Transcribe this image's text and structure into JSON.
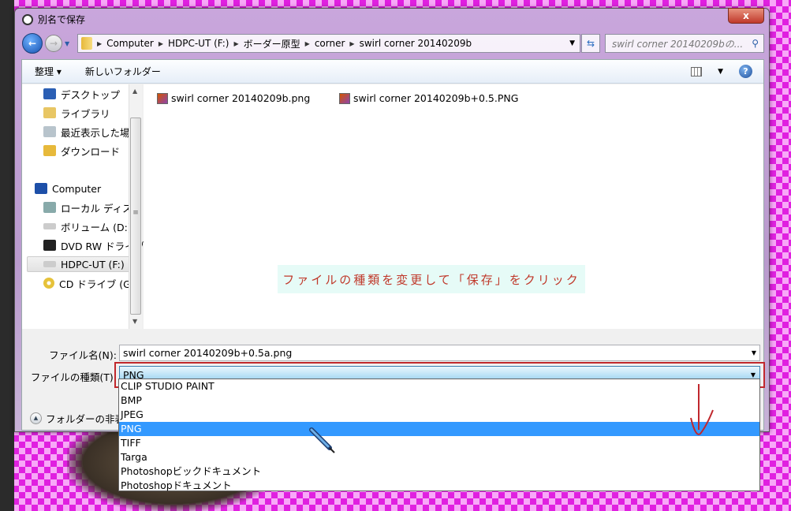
{
  "window": {
    "title": "別名で保存",
    "close": "x"
  },
  "address": {
    "crumbs": [
      "Computer",
      "HDPC-UT (F:)",
      "ボーダー原型",
      "corner",
      "swirl corner 20140209b"
    ]
  },
  "search": {
    "placeholder": "swirl corner 20140209bの..."
  },
  "toolbar": {
    "organize": "整理 ▾",
    "new_folder": "新しいフォルダー",
    "help": "?"
  },
  "nav": {
    "items": [
      "デスクトップ",
      "ライブラリ",
      "最近表示した場所",
      "ダウンロード",
      "Computer",
      "ローカル ディスク",
      "ボリューム (D:)",
      "DVD RW ドライブ",
      "HDPC-UT (F:)",
      "CD ドライブ (G:)"
    ]
  },
  "files": [
    "swirl corner 20140209b.png",
    "swirl corner 20140209b+0.5.PNG"
  ],
  "annotation": "ファイルの種類を変更して「保存」をクリック",
  "form": {
    "filename_label": "ファイル名(N):",
    "filename_value": "swirl corner 20140209b+0.5a.png",
    "type_label": "ファイルの種類(T):",
    "type_value": "PNG",
    "hide_folders": "フォルダーの非表示"
  },
  "type_options": [
    "CLIP STUDIO PAINT",
    "BMP",
    "JPEG",
    "PNG",
    "TIFF",
    "Targa",
    "Photoshopビックドキュメント",
    "Photoshopドキュメント"
  ],
  "selected_option": "PNG",
  "colors": {
    "highlight": "#3399ff",
    "annotation_red": "#c0282d"
  }
}
